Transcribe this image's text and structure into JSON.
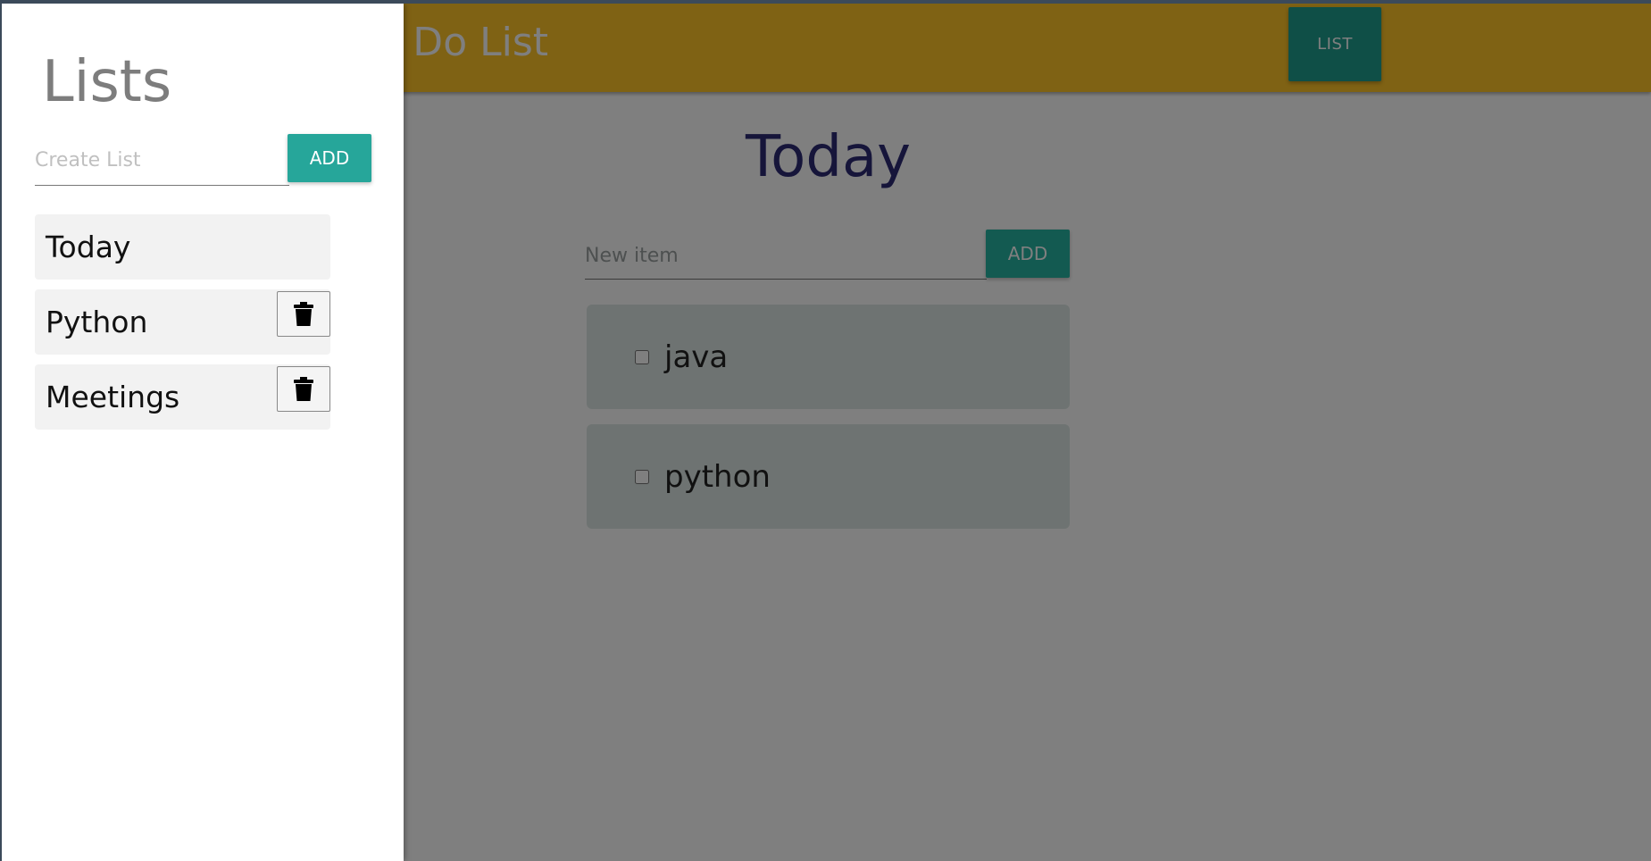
{
  "header": {
    "brand": "To Do List",
    "list_button_label": "LIST"
  },
  "main": {
    "title": "Today",
    "new_item_placeholder": "New item",
    "add_label": "ADD",
    "items": [
      {
        "label": "java",
        "checked": false
      },
      {
        "label": "python",
        "checked": false
      }
    ]
  },
  "drawer": {
    "title": "Lists",
    "create_placeholder": "Create List",
    "add_label": "ADD",
    "lists": [
      {
        "label": "Today",
        "deletable": false
      },
      {
        "label": "Python",
        "deletable": true
      },
      {
        "label": "Meetings",
        "deletable": true
      }
    ],
    "delete_icon": "trash-icon"
  },
  "colors": {
    "navbar": "#ffc428",
    "accent": "#26a69a",
    "title": "#2d2b75",
    "overlay": "rgba(0,0,0,0.5)"
  }
}
